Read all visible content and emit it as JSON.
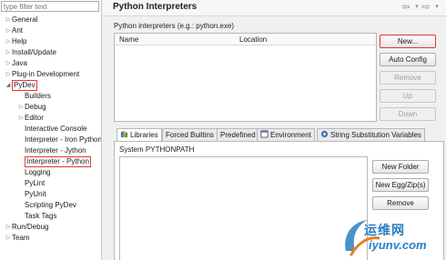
{
  "filter": {
    "placeholder": "type filter text"
  },
  "tree": [
    {
      "label": "General",
      "arrow": "closed"
    },
    {
      "label": "Ant",
      "arrow": "closed"
    },
    {
      "label": "Help",
      "arrow": "closed"
    },
    {
      "label": "Install/Update",
      "arrow": "closed"
    },
    {
      "label": "Java",
      "arrow": "closed"
    },
    {
      "label": "Plug-in Development",
      "arrow": "closed"
    },
    {
      "label": "PyDev",
      "arrow": "open"
    },
    {
      "label": "Builders",
      "arrow": "none"
    },
    {
      "label": "Debug",
      "arrow": "closed"
    },
    {
      "label": "Editor",
      "arrow": "closed"
    },
    {
      "label": "Interactive Console",
      "arrow": "none"
    },
    {
      "label": "Interpreter - Iron Python",
      "arrow": "none"
    },
    {
      "label": "Interpreter - Jython",
      "arrow": "none"
    },
    {
      "label": "Interpreter - Python",
      "arrow": "none"
    },
    {
      "label": "Logging",
      "arrow": "none"
    },
    {
      "label": "PyLint",
      "arrow": "none"
    },
    {
      "label": "PyUnit",
      "arrow": "none"
    },
    {
      "label": "Scripting PyDev",
      "arrow": "none"
    },
    {
      "label": "Task Tags",
      "arrow": "none"
    },
    {
      "label": "Run/Debug",
      "arrow": "closed"
    },
    {
      "label": "Team",
      "arrow": "closed"
    }
  ],
  "header": {
    "title": "Python Interpreters"
  },
  "interpreters": {
    "label": "Python interpreters (e.g.: python.exe)",
    "columns": [
      "Name",
      "Location"
    ]
  },
  "buttons": {
    "new": "New...",
    "auto_config": "Auto Config",
    "remove": "Remove",
    "up": "Up",
    "down": "Down"
  },
  "tabs": [
    "Libraries",
    "Forced Builtins",
    "Predefined",
    "Environment",
    "String Substitution Variables"
  ],
  "libraries": {
    "label": "System PYTHONPATH",
    "new_folder": "New Folder",
    "new_egg": "New Egg/Zip(s)",
    "remove": "Remove"
  },
  "watermark": {
    "cn": "运维网",
    "en": "iyunv.com"
  },
  "colors": {
    "highlight": "#ee3333",
    "watermark": "#2a7fc1"
  }
}
